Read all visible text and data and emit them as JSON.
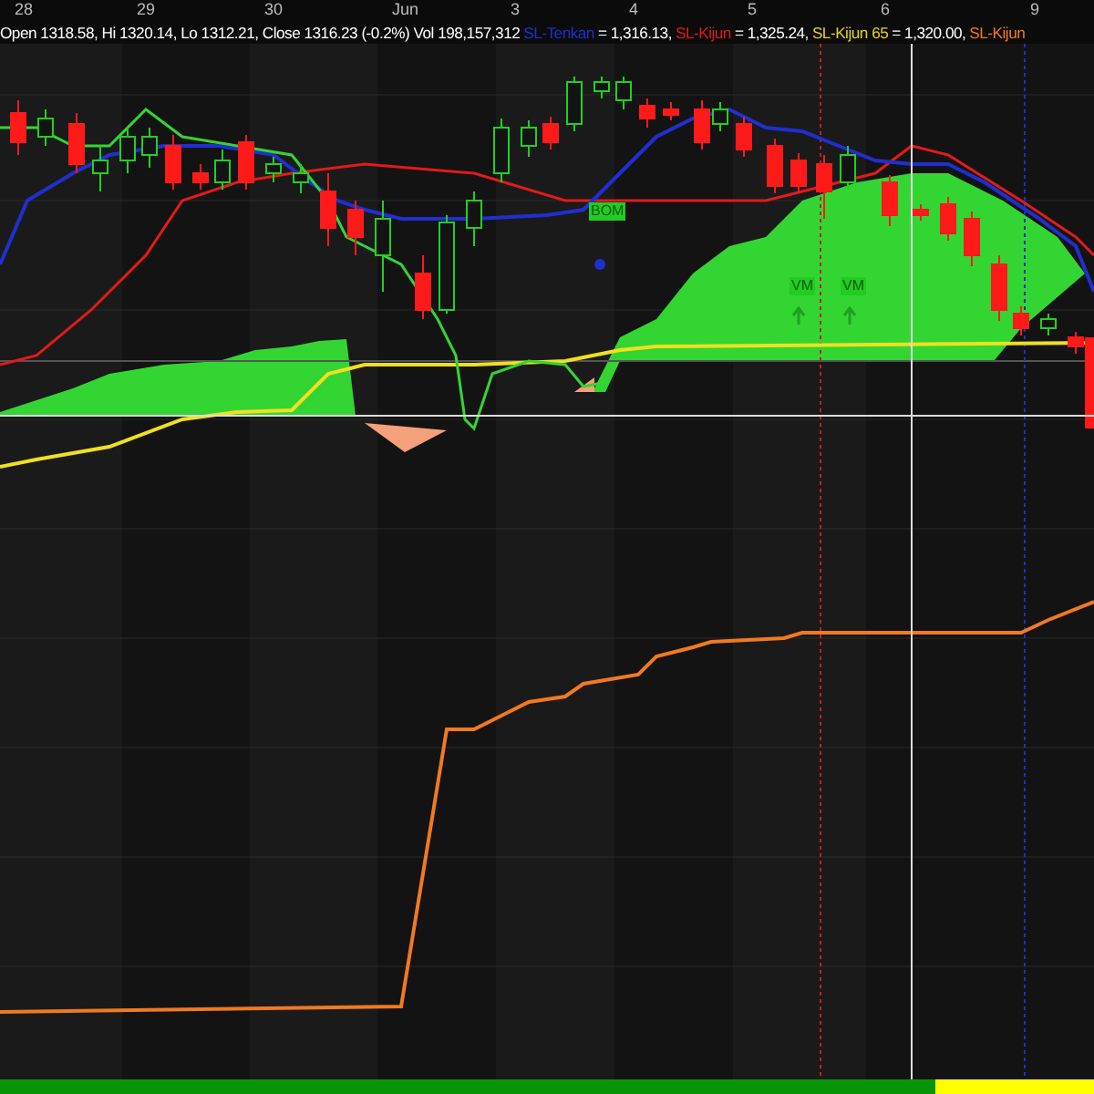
{
  "date_axis": {
    "labels": [
      "28",
      "29",
      "30",
      "Jun",
      "3",
      "4",
      "5",
      "6",
      "9"
    ]
  },
  "info_line": {
    "quote": "Open 1318.58, Hi 1320.14, Lo 1312.21, Close 1316.23 (-0.2%) Vol 198,157,312",
    "indicators": [
      {
        "label": "SL-Tenkan",
        "color": "#1f2fd0",
        "value": "= 1,316.13,"
      },
      {
        "label": "SL-Kijun",
        "color": "#e01b1b",
        "value": "= 1,325.24,"
      },
      {
        "label": "SL-Kijun 65",
        "color": "#e6d21e",
        "value": "= 1,320.00,"
      },
      {
        "label": "SL-Kijun",
        "color": "#f07a20"
      }
    ]
  },
  "markers": [
    {
      "label": "BOM"
    },
    {
      "label": "VM"
    },
    {
      "label": "VM"
    }
  ]
}
